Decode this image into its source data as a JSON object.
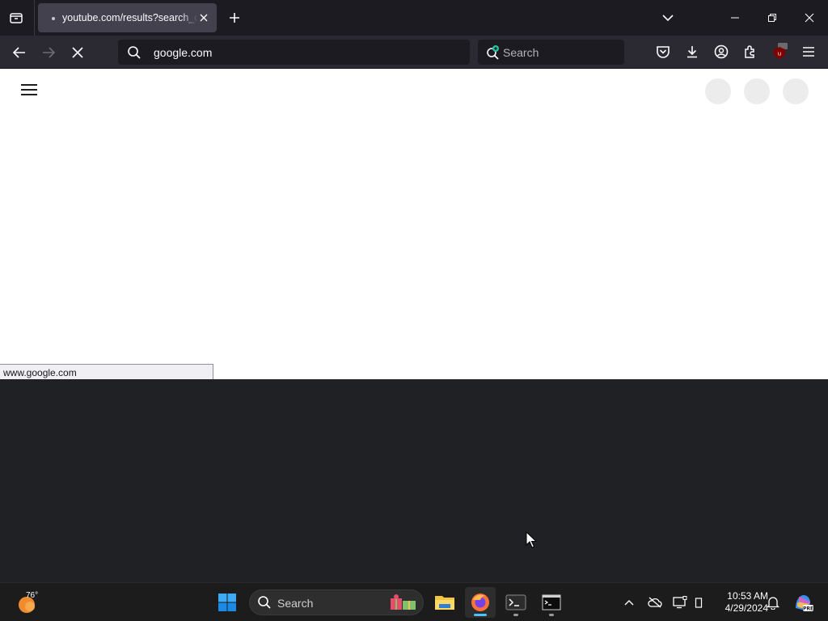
{
  "browser": {
    "tab": {
      "title": "youtube.com/results?search_query"
    },
    "url": "google.com",
    "search_placeholder": "Search",
    "status_url": "www.google.com"
  },
  "taskbar": {
    "weather_temp": "76°",
    "search_label": "Search",
    "time": "10:53 AM",
    "date": "4/29/2024"
  },
  "colors": {
    "firefox_accent": "#0060df",
    "windows_blue": "#0078d4"
  }
}
